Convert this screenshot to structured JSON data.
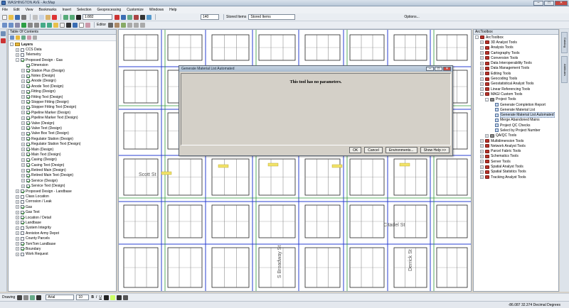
{
  "window": {
    "title": "WASHINGTON AVE - ArcMap"
  },
  "menu": [
    "File",
    "Edit",
    "View",
    "Bookmarks",
    "Insert",
    "Selection",
    "Geoprocessing",
    "Customize",
    "Windows",
    "Help"
  ],
  "toolbar": {
    "scale": "1:882",
    "stored_items_label": "Stored Items",
    "stored_items_value": "Stored Items",
    "editor_label": "Editor",
    "zoom_value": "140",
    "options_label": "Options..."
  },
  "toc": {
    "title": "Table Of Contents",
    "items": [
      {
        "label": "Layers",
        "indent": 0,
        "exp": "-",
        "check": "none",
        "bold": true
      },
      {
        "label": "CCS Data",
        "indent": 1,
        "exp": "+",
        "check": "off"
      },
      {
        "label": "Telemetry",
        "indent": 1,
        "exp": "+",
        "check": "off"
      },
      {
        "label": "Proposed Design - Gas",
        "indent": 1,
        "exp": "-",
        "check": "on"
      },
      {
        "label": "Dimension",
        "indent": 2,
        "exp": "",
        "check": "on"
      },
      {
        "label": "Station Plus (Design)",
        "indent": 2,
        "exp": "+",
        "check": "on"
      },
      {
        "label": "Notes (Design)",
        "indent": 2,
        "exp": "+",
        "check": "on"
      },
      {
        "label": "Anode (Design)",
        "indent": 2,
        "exp": "+",
        "check": "on"
      },
      {
        "label": "Anode Text (Design)",
        "indent": 2,
        "exp": "+",
        "check": "on"
      },
      {
        "label": "Fitting (Design)",
        "indent": 2,
        "exp": "+",
        "check": "on"
      },
      {
        "label": "Fitting Text (Design)",
        "indent": 2,
        "exp": "+",
        "check": "on"
      },
      {
        "label": "Stopper Fitting (Design)",
        "indent": 2,
        "exp": "+",
        "check": "on"
      },
      {
        "label": "Stopper Fitting Text (Design)",
        "indent": 2,
        "exp": "+",
        "check": "on"
      },
      {
        "label": "Pipeline Marker (Design)",
        "indent": 2,
        "exp": "+",
        "check": "on"
      },
      {
        "label": "Pipeline Marker Text (Design)",
        "indent": 2,
        "exp": "+",
        "check": "on"
      },
      {
        "label": "Valve (Design)",
        "indent": 2,
        "exp": "+",
        "check": "on"
      },
      {
        "label": "Valve Text (Design)",
        "indent": 2,
        "exp": "+",
        "check": "on"
      },
      {
        "label": "Valve Box Text (Design)",
        "indent": 2,
        "exp": "+",
        "check": "on"
      },
      {
        "label": "Regulator Station (Design)",
        "indent": 2,
        "exp": "+",
        "check": "on"
      },
      {
        "label": "Regulator Station Text (Design)",
        "indent": 2,
        "exp": "+",
        "check": "on"
      },
      {
        "label": "Main (Design)",
        "indent": 2,
        "exp": "+",
        "check": "on"
      },
      {
        "label": "Main Text (Design)",
        "indent": 2,
        "exp": "+",
        "check": "on"
      },
      {
        "label": "Casing (Design)",
        "indent": 2,
        "exp": "+",
        "check": "on"
      },
      {
        "label": "Casing Text (Design)",
        "indent": 2,
        "exp": "+",
        "check": "on"
      },
      {
        "label": "Retired Main (Design)",
        "indent": 2,
        "exp": "+",
        "check": "on"
      },
      {
        "label": "Retired Main Text (Design)",
        "indent": 2,
        "exp": "+",
        "check": "on"
      },
      {
        "label": "Service (Design)",
        "indent": 2,
        "exp": "+",
        "check": "on"
      },
      {
        "label": "Service Text (Design)",
        "indent": 2,
        "exp": "+",
        "check": "on"
      },
      {
        "label": "Proposed Design - Landbase",
        "indent": 1,
        "exp": "+",
        "check": "on"
      },
      {
        "label": "Class Location",
        "indent": 1,
        "exp": "+",
        "check": "off"
      },
      {
        "label": "Corrosion / Leak",
        "indent": 1,
        "exp": "+",
        "check": "off"
      },
      {
        "label": "Gas",
        "indent": 1,
        "exp": "+",
        "check": "on"
      },
      {
        "label": "Gas Text",
        "indent": 1,
        "exp": "+",
        "check": "on"
      },
      {
        "label": "Location / Detail",
        "indent": 1,
        "exp": "+",
        "check": "on"
      },
      {
        "label": "Landbase",
        "indent": 1,
        "exp": "+",
        "check": "on"
      },
      {
        "label": "System Integrity",
        "indent": 1,
        "exp": "+",
        "check": "off"
      },
      {
        "label": "Anniston Army Depot",
        "indent": 1,
        "exp": "+",
        "check": "off"
      },
      {
        "label": "County Parcels",
        "indent": 1,
        "exp": "+",
        "check": "off"
      },
      {
        "label": "TomTom Landbase",
        "indent": 1,
        "exp": "+",
        "check": "on"
      },
      {
        "label": "Boundary",
        "indent": 1,
        "exp": "+",
        "check": "on"
      },
      {
        "label": "Work Request",
        "indent": 1,
        "exp": "+",
        "check": "off"
      }
    ]
  },
  "map": {
    "street_labels": [
      "Scott St",
      "Citadel St",
      "Derrick St",
      "S Broadway St"
    ]
  },
  "dialog": {
    "title": "Generate Material List Automated",
    "message": "This tool has no parameters.",
    "buttons": [
      "OK",
      "Cancel",
      "Environments...",
      "Show Help >>"
    ]
  },
  "toolbox": {
    "title": "ArcToolbox",
    "items": [
      {
        "label": "ArcToolbox",
        "indent": 0,
        "exp": "-",
        "kind": "box"
      },
      {
        "label": "3D Analyst Tools",
        "indent": 1,
        "exp": "+",
        "kind": "box"
      },
      {
        "label": "Analysis Tools",
        "indent": 1,
        "exp": "+",
        "kind": "box"
      },
      {
        "label": "Cartography Tools",
        "indent": 1,
        "exp": "+",
        "kind": "box"
      },
      {
        "label": "Conversion Tools",
        "indent": 1,
        "exp": "+",
        "kind": "box"
      },
      {
        "label": "Data Interoperability Tools",
        "indent": 1,
        "exp": "+",
        "kind": "box"
      },
      {
        "label": "Data Management Tools",
        "indent": 1,
        "exp": "+",
        "kind": "box"
      },
      {
        "label": "Editing Tools",
        "indent": 1,
        "exp": "+",
        "kind": "box"
      },
      {
        "label": "Geocoding Tools",
        "indent": 1,
        "exp": "+",
        "kind": "box"
      },
      {
        "label": "Geostatistical Analyst Tools",
        "indent": 1,
        "exp": "+",
        "kind": "box"
      },
      {
        "label": "Linear Referencing Tools",
        "indent": 1,
        "exp": "+",
        "kind": "box"
      },
      {
        "label": "MAGI Custom Tools",
        "indent": 1,
        "exp": "-",
        "kind": "box"
      },
      {
        "label": "Project Tools",
        "indent": 2,
        "exp": "-",
        "kind": "box"
      },
      {
        "label": "Generate Completion Report",
        "indent": 3,
        "exp": "",
        "kind": "tool"
      },
      {
        "label": "Generate Material List",
        "indent": 3,
        "exp": "",
        "kind": "tool"
      },
      {
        "label": "Generate Material List Automated",
        "indent": 3,
        "exp": "",
        "kind": "tool",
        "selected": true
      },
      {
        "label": "Merge Abandoned Mains",
        "indent": 3,
        "exp": "",
        "kind": "tool"
      },
      {
        "label": "Project QC Checks",
        "indent": 3,
        "exp": "",
        "kind": "tool"
      },
      {
        "label": "Select by Project Number",
        "indent": 3,
        "exp": "",
        "kind": "tool"
      },
      {
        "label": "QA/QC Tools",
        "indent": 2,
        "exp": "+",
        "kind": "box"
      },
      {
        "label": "Multidimension Tools",
        "indent": 1,
        "exp": "+",
        "kind": "box"
      },
      {
        "label": "Network Analyst Tools",
        "indent": 1,
        "exp": "+",
        "kind": "box"
      },
      {
        "label": "Parcel Fabric Tools",
        "indent": 1,
        "exp": "+",
        "kind": "box"
      },
      {
        "label": "Schematics Tools",
        "indent": 1,
        "exp": "+",
        "kind": "box"
      },
      {
        "label": "Server Tools",
        "indent": 1,
        "exp": "+",
        "kind": "box"
      },
      {
        "label": "Spatial Analyst Tools",
        "indent": 1,
        "exp": "+",
        "kind": "box"
      },
      {
        "label": "Spatial Statistics Tools",
        "indent": 1,
        "exp": "+",
        "kind": "box"
      },
      {
        "label": "Tracking Analyst Tools",
        "indent": 1,
        "exp": "+",
        "kind": "box"
      }
    ]
  },
  "side_tabs": [
    "Catalog",
    "Attributes"
  ],
  "drawing": {
    "label": "Drawing",
    "font": "Arial",
    "size": "10"
  },
  "status": {
    "coordinates": "-86.087  32.374 Decimal Degrees"
  }
}
